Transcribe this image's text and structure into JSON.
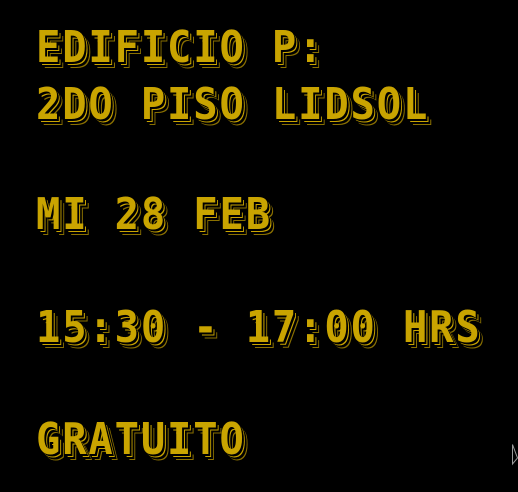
{
  "lines": {
    "building": "EDIFICIO P:",
    "floor": "2DO PISO LIDSOL",
    "date": "MI 28 FEB",
    "time": "15:30 - 17:00 HRS",
    "price": "GRATUITO"
  },
  "colors": {
    "background": "#000000",
    "text": "#c9a400",
    "shadow": "#8a7000"
  },
  "icons": {
    "cursor": "mouse-pointer-icon"
  }
}
